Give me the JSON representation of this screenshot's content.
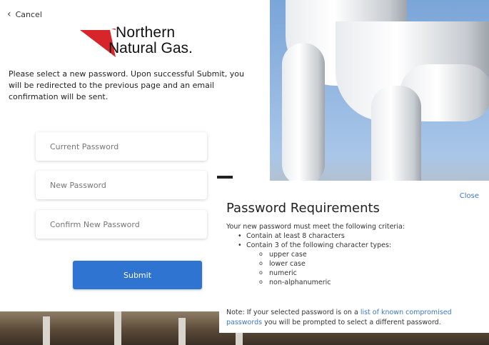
{
  "cancel": {
    "label": "Cancel"
  },
  "logo": {
    "line1": "Northern",
    "line2": "Natural Gas."
  },
  "intro_text": "Please select a new password. Upon successful Submit, you will be redirected to the previous page and an email confirmation will be sent.",
  "form": {
    "current_password_placeholder": "Current Password",
    "new_password_placeholder": "New Password",
    "confirm_password_placeholder": "Confirm New Password",
    "submit_label": "Submit"
  },
  "requirements": {
    "close_label": "Close",
    "title": "Password Requirements",
    "lead": "Your new password must meet the following criteria:",
    "bullet1": "Contain at least 8 characters",
    "bullet2": "Contain 3 of the following character types:",
    "types": [
      "upper case",
      "lower case",
      "numeric",
      "non-alphanumeric"
    ],
    "note_prefix": "Note: If your selected password is on a ",
    "note_link": "list of known compromised passwords",
    "note_suffix": " you will be prompted to select a different password."
  },
  "colors": {
    "accent": "#2f74d0",
    "logo_red": "#d7262b",
    "link": "#3b78c4"
  }
}
